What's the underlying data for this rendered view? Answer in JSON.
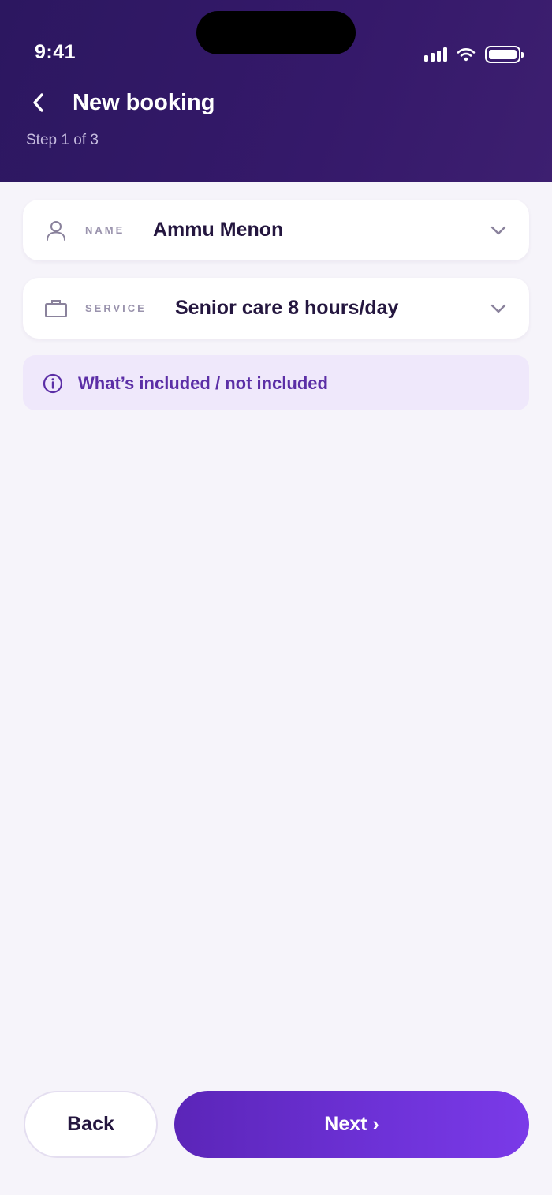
{
  "status_bar": {
    "time": "9:41",
    "icons": [
      "signal-icon",
      "wifi-icon",
      "battery-icon"
    ]
  },
  "header": {
    "title": "New booking",
    "step": "Step 1 of 3",
    "back_icon": "chevron-left-icon"
  },
  "fields": {
    "name": {
      "label": "NAME",
      "value": "Ammu Menon",
      "icon": "person-icon"
    },
    "service": {
      "label": "SERVICE",
      "value": "Senior care 8 hours/day",
      "icon": "briefcase-icon"
    }
  },
  "info": {
    "text": "What’s included / not included",
    "icon": "info-icon"
  },
  "footer": {
    "back_label": "Back",
    "next_label": "Next ›"
  },
  "colors": {
    "header_bg": "#2c1760",
    "accent": "#6e32d8",
    "info_bg": "#efe8fb",
    "info_text": "#5b2ea6",
    "page_bg": "#f6f4fa"
  }
}
